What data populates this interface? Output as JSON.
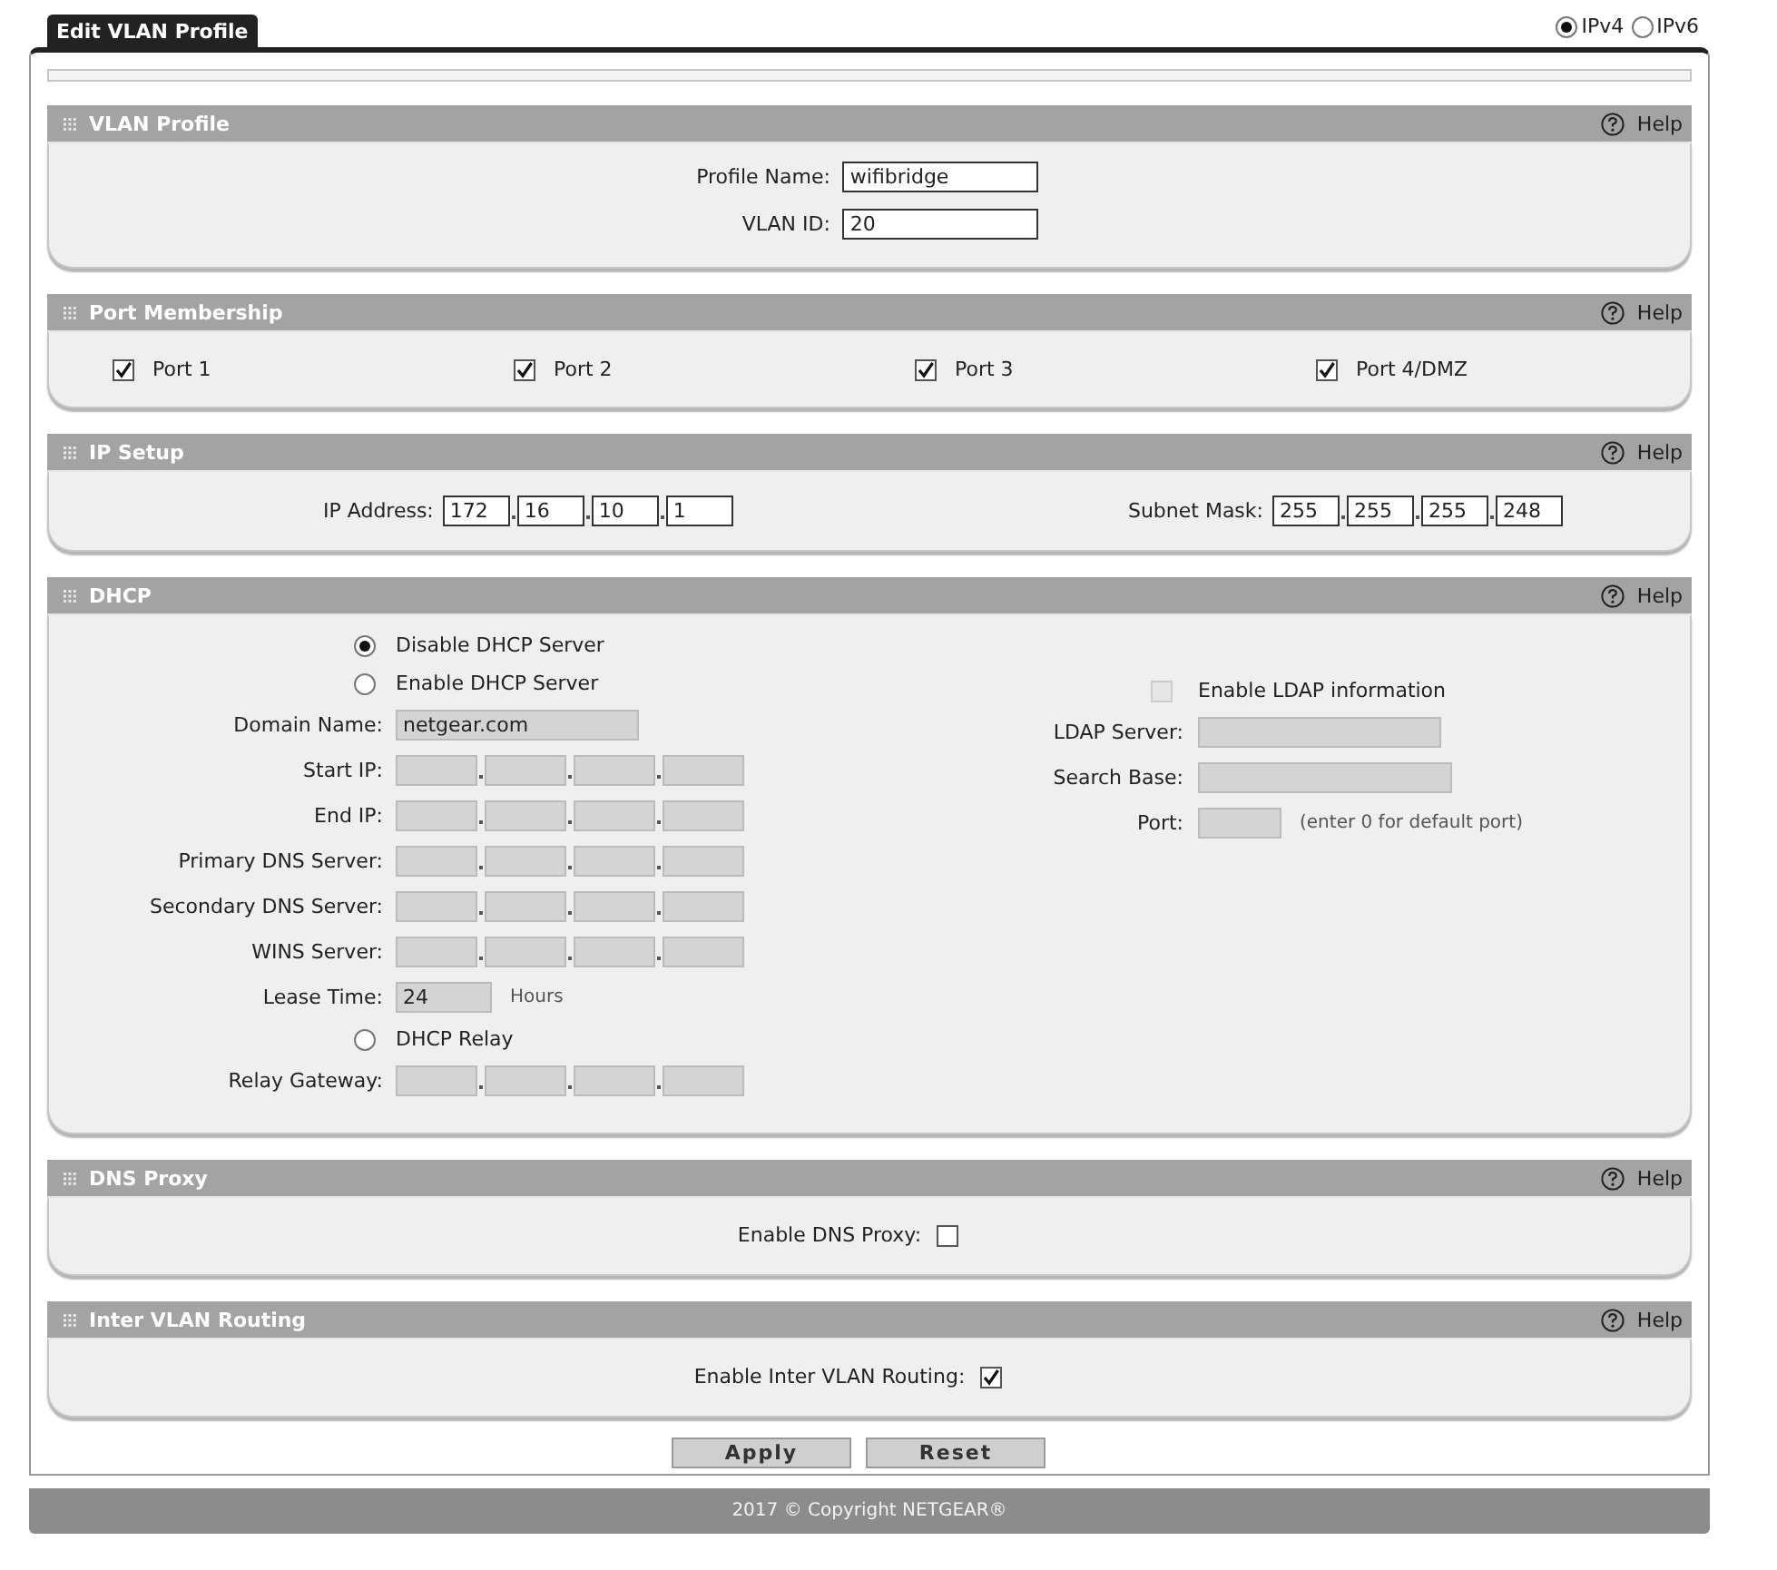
{
  "page_tab": "Edit VLAN Profile",
  "ip_versions": [
    {
      "label": "IPv4",
      "selected": true
    },
    {
      "label": "IPv6",
      "selected": false
    }
  ],
  "sections": [
    {
      "kind": "profile",
      "title": "VLAN Profile",
      "help": "Help",
      "fields": [
        {
          "label": "Profile Name:",
          "value": "wifibridge"
        },
        {
          "label": "VLAN ID:",
          "value": "20"
        }
      ]
    },
    {
      "kind": "ports",
      "title": "Port Membership",
      "help": "Help",
      "ports": [
        {
          "label": "Port 1",
          "checked": true
        },
        {
          "label": "Port 2",
          "checked": true
        },
        {
          "label": "Port 3",
          "checked": true
        },
        {
          "label": "Port 4/DMZ",
          "checked": true
        }
      ]
    },
    {
      "kind": "ip",
      "title": "IP Setup",
      "help": "Help",
      "groups": [
        {
          "label": "IP Address:",
          "octets": [
            "172",
            "16",
            "10",
            "1"
          ]
        },
        {
          "label": "Subnet Mask:",
          "octets": [
            "255",
            "255",
            "255",
            "248"
          ]
        }
      ]
    },
    {
      "kind": "dhcp",
      "title": "DHCP",
      "help": "Help",
      "left": [
        {
          "kind": "radio",
          "label": "Disable DHCP Server",
          "selected": true
        },
        {
          "kind": "radio",
          "label": "Enable DHCP Server",
          "selected": false
        },
        {
          "kind": "text",
          "label": "Domain Name:",
          "value": "netgear.com",
          "disabled": true
        },
        {
          "kind": "ip",
          "label": "Start IP:",
          "disabled": true
        },
        {
          "kind": "ip",
          "label": "End IP:",
          "disabled": true
        },
        {
          "kind": "ip",
          "label": "Primary DNS Server:",
          "disabled": true
        },
        {
          "kind": "ip",
          "label": "Secondary DNS Server:",
          "disabled": true
        },
        {
          "kind": "ip",
          "label": "WINS Server:",
          "disabled": true
        },
        {
          "kind": "lease",
          "label": "Lease Time:",
          "value": "24",
          "unit": "Hours",
          "disabled": true
        },
        {
          "kind": "radio",
          "label": "DHCP Relay",
          "selected": false
        },
        {
          "kind": "ip",
          "label": "Relay Gateway:",
          "disabled": true
        }
      ],
      "right": [
        {
          "kind": "check",
          "label": "Enable LDAP information",
          "checked": false,
          "disabled": true
        },
        {
          "kind": "text",
          "label": "LDAP Server:",
          "disabled": true
        },
        {
          "kind": "wide",
          "label": "Search Base:",
          "disabled": true
        },
        {
          "kind": "port",
          "label": "Port:",
          "hint": "(enter 0 for default port)",
          "disabled": true
        }
      ]
    },
    {
      "kind": "toggle",
      "title": "DNS Proxy",
      "help": "Help",
      "label": "Enable DNS Proxy:",
      "checked": false
    },
    {
      "kind": "toggle",
      "title": "Inter VLAN Routing",
      "help": "Help",
      "label": "Enable Inter VLAN Routing:",
      "checked": true
    }
  ],
  "buttons": [
    "Apply",
    "Reset"
  ],
  "footer": "2017 © Copyright NETGEAR®"
}
